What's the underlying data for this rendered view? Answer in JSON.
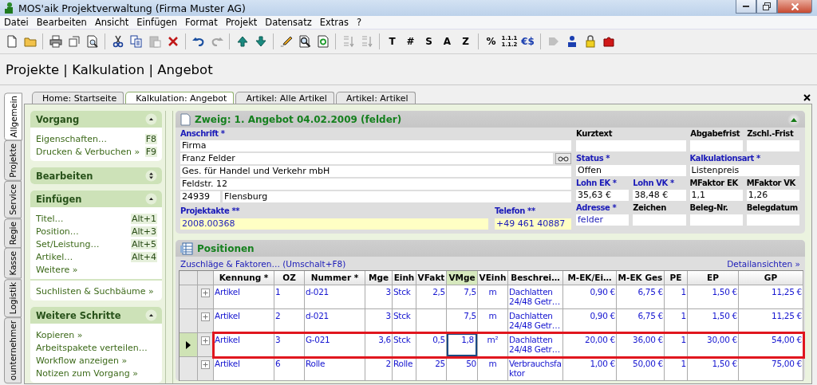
{
  "window": {
    "title": "MOS'aik Projektverwaltung (Firma Muster AG)"
  },
  "menu": [
    "Datei",
    "Bearbeiten",
    "Ansicht",
    "Einfügen",
    "Format",
    "Projekt",
    "Datensatz",
    "Extras",
    "?"
  ],
  "toolbar": [
    {
      "kind": "icon",
      "disabled": false
    },
    {
      "kind": "icon",
      "disabled": false
    },
    {
      "kind": "separator"
    },
    {
      "kind": "icon",
      "disabled": false
    },
    {
      "kind": "icon",
      "disabled": false
    },
    {
      "kind": "icon",
      "disabled": false
    },
    {
      "kind": "separator"
    },
    {
      "kind": "icon",
      "disabled": false
    },
    {
      "kind": "icon",
      "disabled": false
    },
    {
      "kind": "icon",
      "disabled": true
    },
    {
      "kind": "icon",
      "disabled": false
    },
    {
      "kind": "separator"
    },
    {
      "kind": "icon",
      "disabled": false
    },
    {
      "kind": "icon",
      "disabled": true
    },
    {
      "kind": "separator"
    },
    {
      "kind": "icon",
      "disabled": false
    },
    {
      "kind": "icon",
      "disabled": false
    },
    {
      "kind": "separator"
    },
    {
      "kind": "icon",
      "disabled": false
    },
    {
      "kind": "icon",
      "disabled": false
    },
    {
      "kind": "icon",
      "disabled": false
    },
    {
      "kind": "separator"
    },
    {
      "kind": "icon",
      "disabled": true
    },
    {
      "kind": "icon",
      "disabled": true
    },
    {
      "kind": "separator"
    },
    {
      "kind": "text",
      "text": "T"
    },
    {
      "kind": "text",
      "text": "#"
    },
    {
      "kind": "text",
      "text": "S"
    },
    {
      "kind": "text",
      "text": "A"
    },
    {
      "kind": "text",
      "text": "Z"
    },
    {
      "kind": "separator"
    },
    {
      "kind": "text",
      "text": "%"
    },
    {
      "kind": "stack",
      "lines": [
        "1.1.1",
        "1.1.2"
      ]
    },
    {
      "kind": "text",
      "text": "€$"
    },
    {
      "kind": "separator"
    },
    {
      "kind": "icon",
      "disabled": true
    },
    {
      "kind": "icon",
      "disabled": false
    },
    {
      "kind": "icon",
      "disabled": false
    },
    {
      "kind": "icon",
      "disabled": false
    }
  ],
  "breadcrumb": "Projekte | Kalkulation | Angebot",
  "side_tabs": [
    {
      "label": "Allgemein",
      "selected": true
    },
    {
      "label": "Projekte",
      "selected": false
    },
    {
      "label": "Service",
      "selected": false
    },
    {
      "label": "Regie",
      "selected": false
    },
    {
      "label": "Kasse",
      "selected": false
    },
    {
      "label": "Logistik",
      "selected": false
    },
    {
      "label": "ounternehmer",
      "selected": false
    }
  ],
  "doc_tabs": [
    {
      "label": "Home: Startseite",
      "selected": false
    },
    {
      "label": "Kalkulation: Angebot",
      "selected": true
    },
    {
      "label": "Artikel: Alle Artikel",
      "selected": false
    },
    {
      "label": "Artikel: Artikel",
      "selected": false
    }
  ],
  "task_pane": [
    {
      "title": "Vorgang",
      "expanded": true,
      "groups": [
        [
          {
            "label": "Eigenschaften…",
            "shortcut": "F8"
          },
          {
            "label": "Drucken & Verbuchen »",
            "shortcut": "F9"
          }
        ]
      ]
    },
    {
      "title": "Bearbeiten",
      "expanded": false
    },
    {
      "title": "Einfügen",
      "expanded": true,
      "groups": [
        [
          {
            "label": "Titel…",
            "shortcut": "Alt+1"
          },
          {
            "label": "Position…",
            "shortcut": "Alt+3"
          },
          {
            "label": "Set/Leistung…",
            "shortcut": "Alt+5"
          },
          {
            "label": "Artikel…",
            "shortcut": "Alt+4"
          },
          {
            "label": "Weitere »"
          }
        ],
        [
          {
            "label": "Suchlisten & Suchbäume »"
          }
        ]
      ]
    },
    {
      "title": "Weitere Schritte",
      "expanded": true,
      "groups": [
        [
          {
            "label": "Kopieren »"
          },
          {
            "label": "Arbeitspakete verteilen…"
          },
          {
            "label": "Workflow anzeigen »"
          },
          {
            "label": "Notizen zum Vorgang »"
          }
        ]
      ]
    }
  ],
  "header_panel": {
    "title": "Zweig: 1. Angebot 04.02.2009 (felder)",
    "expanded": true,
    "address": {
      "label": "Anschrift *",
      "linked": true,
      "lines": [
        "Firma",
        "Franz Felder",
        "Ges. für Handel und Verkehr mbH",
        "Feldstr. 12"
      ],
      "zip": "24939",
      "city": "Flensburg"
    },
    "bottom_fields": [
      {
        "label": "Projektakte **",
        "linked": true,
        "value": "2008.00368",
        "linked_value": true,
        "highlighted": true
      },
      {
        "label": "Telefon **",
        "linked": true,
        "value": "+49 461 40887",
        "linked_value": true,
        "highlighted": true
      }
    ],
    "field_rows": [
      [
        {
          "label": "Kurztext",
          "linked": false
        },
        {
          "label": "Abgabefrist",
          "linked": false
        },
        {
          "label": "Zschl.-Frist",
          "linked": false
        }
      ],
      [
        {
          "label": "Status *",
          "linked": true,
          "value": "Offen"
        },
        {
          "label": "Kalkulationsart *",
          "linked": true,
          "value": "Listenpreis"
        }
      ],
      [
        {
          "label": "Lohn EK *",
          "linked": true,
          "value": "35,63 €"
        },
        {
          "label": "Lohn VK *",
          "linked": true,
          "value": "38,48 €"
        },
        {
          "label": "MFaktor EK",
          "linked": false,
          "value": "1,1"
        },
        {
          "label": "MFaktor VK",
          "linked": false,
          "value": "1,26"
        }
      ],
      [
        {
          "label": "Adresse *",
          "linked": true,
          "value": "felder",
          "linked_value": true
        },
        {
          "label": "Zeichen",
          "linked": false
        },
        {
          "label": "Beleg-Nr.",
          "linked": false
        },
        {
          "label": "Belegdatum",
          "linked": false
        }
      ]
    ]
  },
  "positions": {
    "title": "Positionen",
    "link_left": "Zuschläge & Faktoren… (Umschalt+F8)",
    "link_right": "Detailansichten »",
    "columns": [
      {
        "label": "Kennung *",
        "kind": "text",
        "selected": false
      },
      {
        "label": "OZ",
        "kind": "text",
        "selected": false
      },
      {
        "label": "Nummer *",
        "kind": "text",
        "selected": false
      },
      {
        "label": "Mge",
        "kind": "number",
        "selected": false
      },
      {
        "label": "Einh",
        "kind": "text",
        "selected": false
      },
      {
        "label": "VFakt",
        "kind": "number",
        "selected": false
      },
      {
        "label": "VMge",
        "kind": "number",
        "selected": true
      },
      {
        "label": "VEinh",
        "kind": "unit",
        "selected": false
      },
      {
        "label": "Beschrei…",
        "kind": "text",
        "selected": false
      },
      {
        "label": "M-EK/Ei…",
        "kind": "number",
        "selected": false
      },
      {
        "label": "M-EK Ges",
        "kind": "number",
        "selected": false
      },
      {
        "label": "PE",
        "kind": "number",
        "selected": false
      },
      {
        "label": "EP",
        "kind": "number",
        "selected": false
      },
      {
        "label": "GP",
        "kind": "number",
        "selected": false
      }
    ],
    "rows": [
      {
        "selected": false,
        "cells": [
          "Artikel",
          "1",
          "d-021",
          "3",
          "Stck",
          "2,5",
          "7,5",
          "m",
          "Dachlatten 24/48 Getr…",
          "0,90 €",
          "6,75 €",
          "1",
          "1,50 €",
          "11,25 €"
        ]
      },
      {
        "selected": false,
        "cells": [
          "Artikel",
          "2",
          "d-021",
          "3",
          "Stck",
          null,
          "7,5",
          "m",
          "Dachlatten 24/48 Getr…",
          "0,90 €",
          "6,75 €",
          "1",
          "1,50 €",
          "11,25 €"
        ]
      },
      {
        "selected": true,
        "cells": [
          "Artikel",
          "3",
          "G-021",
          "3,6",
          "Stck",
          "0,5",
          "1,8",
          "m²",
          "Dachlatten 24/48 Getr…",
          "20,00 €",
          "36,00 €",
          "1",
          "30,00 €",
          "54,00 €"
        ]
      },
      {
        "selected": false,
        "cells": [
          "Artikel",
          "6",
          "Rolle",
          "2",
          "Rolle",
          "25",
          "50",
          "m",
          "Verbrauchsfaktor",
          "1,00 €",
          "50,00 €",
          "1",
          "1,50 €",
          "75,00 €"
        ]
      }
    ]
  }
}
